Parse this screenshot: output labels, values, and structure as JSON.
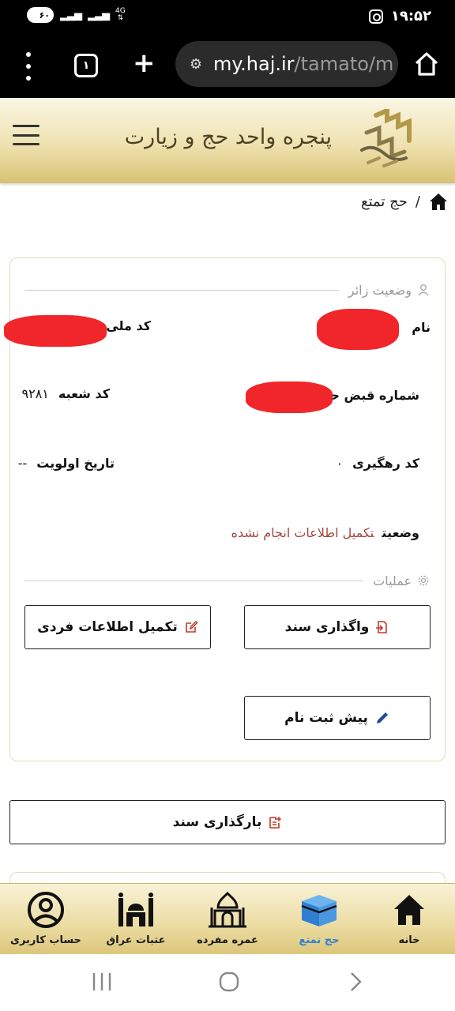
{
  "status_bar": {
    "battery": "۶۰",
    "network": "4G",
    "time": "۱۹:۵۲"
  },
  "browser": {
    "tab_count": "۱",
    "url_host": "my.haj.ir",
    "url_path": "/tamato/m"
  },
  "header": {
    "title": "پنجره واحد حج و زیارت"
  },
  "breadcrumb": {
    "separator": "/",
    "current": "حج تمتع"
  },
  "pilgrim_status": {
    "section_title": "وضعیت زائر",
    "fields": {
      "name_label": "نام",
      "national_code_label": "کد ملی",
      "receipt_label": "شماره قبض حج",
      "branch_code_label": "کد شعبه",
      "branch_code_value": "۹۲۸۱",
      "tracking_code_label": "کد رهگیری",
      "tracking_code_value": "۰",
      "priority_date_label": "تاریخ اولویت",
      "priority_date_value": "--",
      "status_label": "وضعیت",
      "status_value": "تکمیل اطلاعات انجام نشده"
    }
  },
  "operations": {
    "section_title": "عملیات",
    "transfer_document": "واگذاری سند",
    "complete_info": "تکمیل اطلاعات فردی",
    "pre_register": "پیش ثبت نام"
  },
  "upload_document": "بارگذاری سند",
  "bottom_nav": [
    {
      "label": "خانه",
      "icon": "home-icon"
    },
    {
      "label": "حج تمتع",
      "icon": "kaaba-icon"
    },
    {
      "label": "عمره مفرده",
      "icon": "mosque-icon"
    },
    {
      "label": "عتبات عراق",
      "icon": "shrine-icon"
    },
    {
      "label": "حساب کاربری",
      "icon": "account-icon"
    }
  ],
  "colors": {
    "accent_gold": "#d8c272",
    "status_red": "#a3473c",
    "active_blue": "#2f7fd0"
  }
}
